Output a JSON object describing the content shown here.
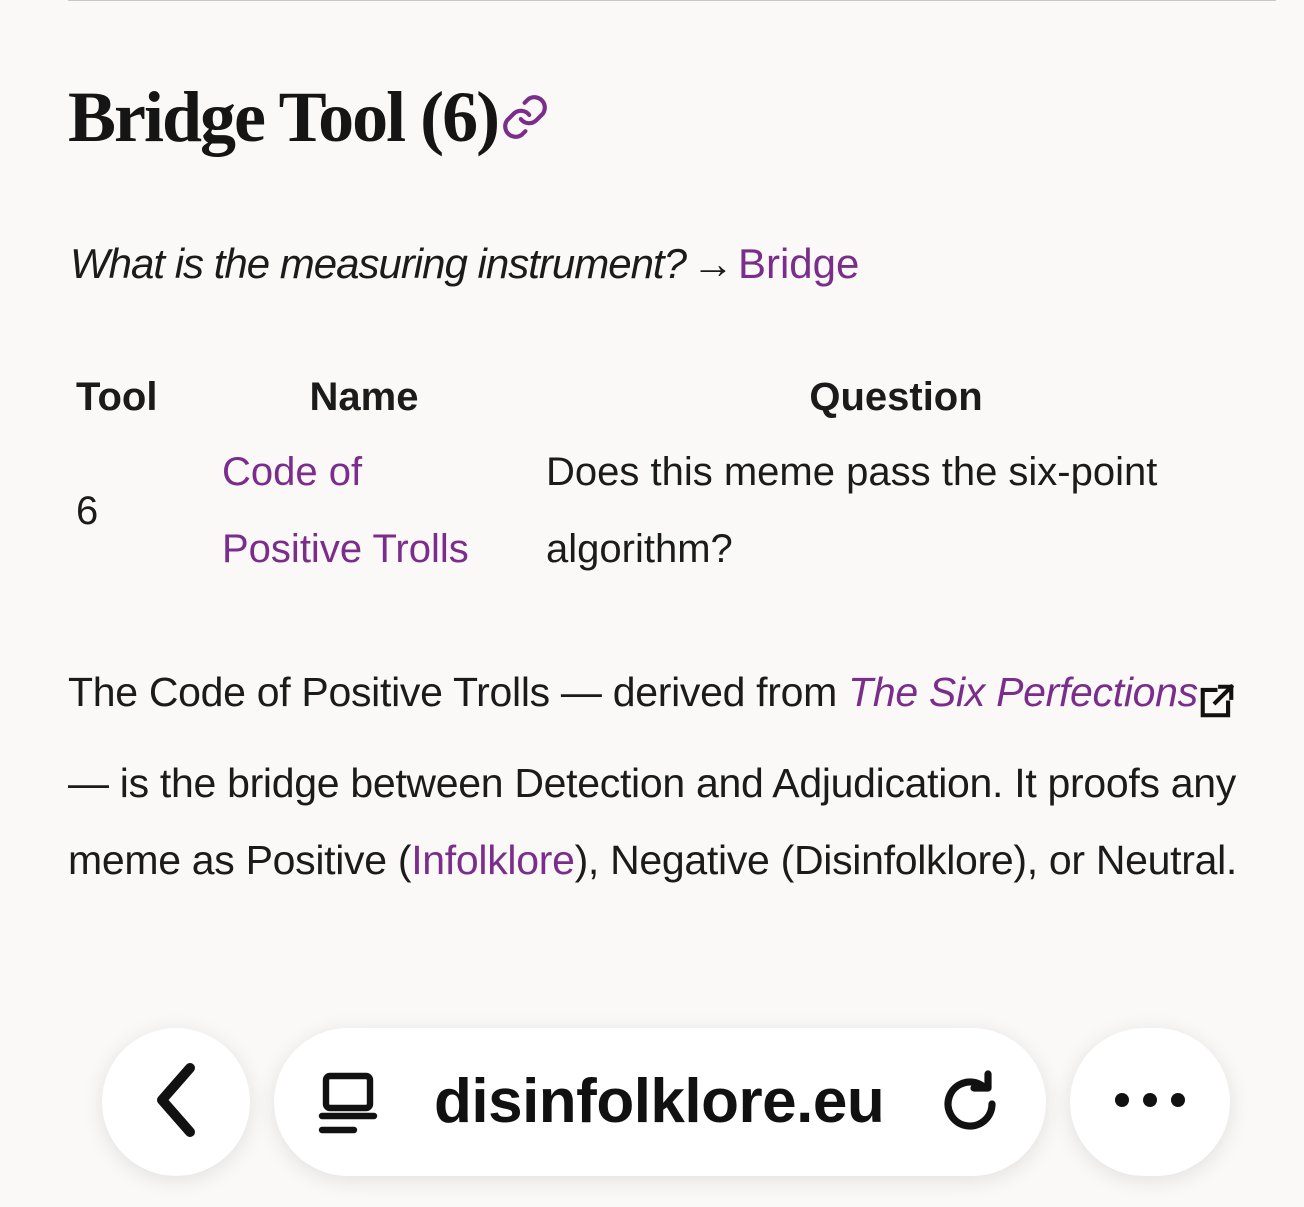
{
  "heading": {
    "title": "Bridge Tool (6)"
  },
  "intro": {
    "question": "What is the measuring instrument?",
    "arrow": "→",
    "link": "Bridge"
  },
  "table": {
    "headers": [
      "Tool",
      "Name",
      "Question"
    ],
    "rows": [
      {
        "tool": "6",
        "name": "Code of Positive Trolls",
        "question": "Does this meme pass the six-point algorithm?"
      }
    ]
  },
  "paragraph": {
    "part1": "The Code of Positive Trolls — derived from ",
    "italic_link": "The Six Perfections",
    "part2": " — is the bridge between Detection and Adjudication. It proofs any meme as Positive (",
    "link2": "Infolklore",
    "part3": "), Negative (Disinfolklore), or Neutral."
  },
  "browser": {
    "url": "disinfolklore.eu",
    "icons": [
      "back-chevron-icon",
      "site-settings-icon",
      "reload-icon",
      "more-dots-icon"
    ]
  },
  "colors": {
    "link": "#7b2d8b",
    "background": "#faf9f8",
    "text": "#1b1b1b"
  }
}
